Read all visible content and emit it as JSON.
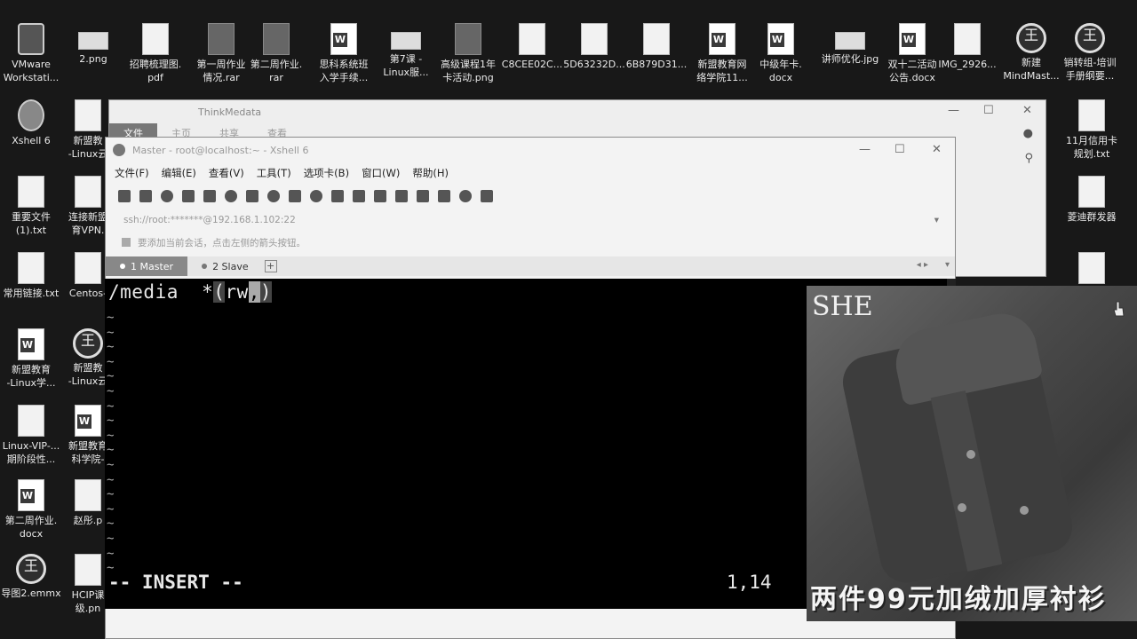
{
  "desktop": {
    "icons_top": [
      {
        "label1": "VMware",
        "label2": "Workstati...",
        "type": "vm"
      },
      {
        "label1": "2.png",
        "label2": "",
        "type": "img"
      },
      {
        "label1": "招聘梳理图.",
        "label2": "pdf",
        "type": "doc"
      },
      {
        "label1": "第一周作业",
        "label2": "情况.rar",
        "type": "folder"
      },
      {
        "label1": "第二周作业.",
        "label2": "rar",
        "type": "folder"
      },
      {
        "label1": "思科系统班",
        "label2": "入学手续...",
        "type": "word"
      },
      {
        "label1": "第7课 -",
        "label2": "Linux服...",
        "type": "img"
      },
      {
        "label1": "高级课程1年",
        "label2": "卡活动.png",
        "type": "folder"
      },
      {
        "label1": "C8CEE02C...",
        "label2": "",
        "type": "doc"
      },
      {
        "label1": "5D63232D...",
        "label2": "",
        "type": "doc"
      },
      {
        "label1": "6B879D31...",
        "label2": "",
        "type": "doc"
      },
      {
        "label1": "新盟教育网",
        "label2": "络学院11...",
        "type": "word"
      },
      {
        "label1": "中级年卡.",
        "label2": "docx",
        "type": "word"
      },
      {
        "label1": "讲师优化.jpg",
        "label2": "",
        "type": "img"
      },
      {
        "label1": "双十二活动",
        "label2": "公告.docx",
        "type": "word"
      },
      {
        "label1": "IMG_2926...",
        "label2": "",
        "type": "doc"
      },
      {
        "label1": "新建",
        "label2": "MindMast...",
        "type": "round"
      },
      {
        "label1": "销转组-培训",
        "label2": "手册纲要...",
        "type": "round"
      }
    ],
    "icons_left": [
      {
        "label1": "Xshell 6",
        "label2": "",
        "type": "shell"
      },
      {
        "label1": "重要文件",
        "label2": "(1).txt",
        "type": "doc"
      },
      {
        "label1": "常用链接.txt",
        "label2": "",
        "type": "doc"
      },
      {
        "label1": "新盟教育",
        "label2": "-Linux学...",
        "type": "word"
      },
      {
        "label1": "Linux-VIP-...",
        "label2": "期阶段性...",
        "type": "doc"
      },
      {
        "label1": "第二周作业.",
        "label2": "docx",
        "type": "word"
      },
      {
        "label1": "导图2.emmx",
        "label2": "",
        "type": "round"
      }
    ],
    "icons_left2": [
      {
        "label1": "新盟教",
        "label2": "-Linux云",
        "type": "doc"
      },
      {
        "label1": "连接新盟",
        "label2": "育VPN.",
        "type": "doc"
      },
      {
        "label1": "Centos-",
        "label2": "",
        "type": "doc"
      },
      {
        "label1": "新盟教",
        "label2": "-Linux云",
        "type": "round"
      },
      {
        "label1": "新盟教育",
        "label2": "科学院-",
        "type": "word"
      },
      {
        "label1": "赵彤.p",
        "label2": "",
        "type": "doc"
      },
      {
        "label1": "HCIP课",
        "label2": "级.pn",
        "type": "doc"
      }
    ],
    "icons_right": [
      {
        "label1": "11月信用卡",
        "label2": "规划.txt",
        "type": "doc"
      },
      {
        "label1": "菱迪群发器",
        "label2": "",
        "type": "doc"
      },
      {
        "label1": "",
        "label2": "",
        "type": "doc"
      }
    ]
  },
  "explorer": {
    "title": "ThinkMedata",
    "tabs": [
      "文件",
      "主页",
      "共享",
      "查看"
    ]
  },
  "xshell": {
    "title": "Master - root@localhost:~ - Xshell 6",
    "menu": [
      "文件(F)",
      "编辑(E)",
      "查看(V)",
      "工具(T)",
      "选项卡(B)",
      "窗口(W)",
      "帮助(H)"
    ],
    "address": "ssh://root:*******@192.168.1.102:22",
    "hint": "要添加当前会话，点击左侧的箭头按钮。",
    "tabs": [
      {
        "label": "1 Master",
        "active": true
      },
      {
        "label": "2 Slave",
        "active": false
      }
    ],
    "add_tab": "+"
  },
  "terminal": {
    "line_prefix": "/media  *",
    "paren_open": "(",
    "rw": "rw",
    "comma": ",",
    "paren_close": ")",
    "tilde": "~",
    "mode": "-- INSERT --",
    "position": "1,14"
  },
  "video": {
    "logo": "SHE",
    "caption": "两件99元加绒加厚衬衫"
  }
}
